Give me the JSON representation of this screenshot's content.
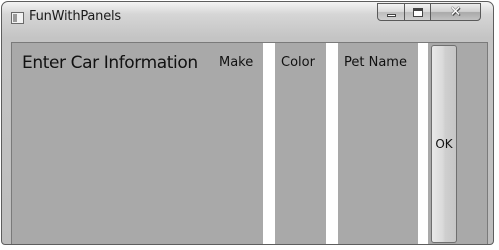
{
  "window": {
    "title": "FunWithPanels",
    "buttons": {
      "minimize": "minimize-icon",
      "maximize": "maximize-icon",
      "close": "close-icon"
    }
  },
  "content": {
    "heading": "Enter Car Information",
    "fields": [
      {
        "label": "Make"
      },
      {
        "label": "Color"
      },
      {
        "label": "Pet Name"
      }
    ],
    "ok_label": "OK",
    "panel_color": "#a9a9a9"
  }
}
